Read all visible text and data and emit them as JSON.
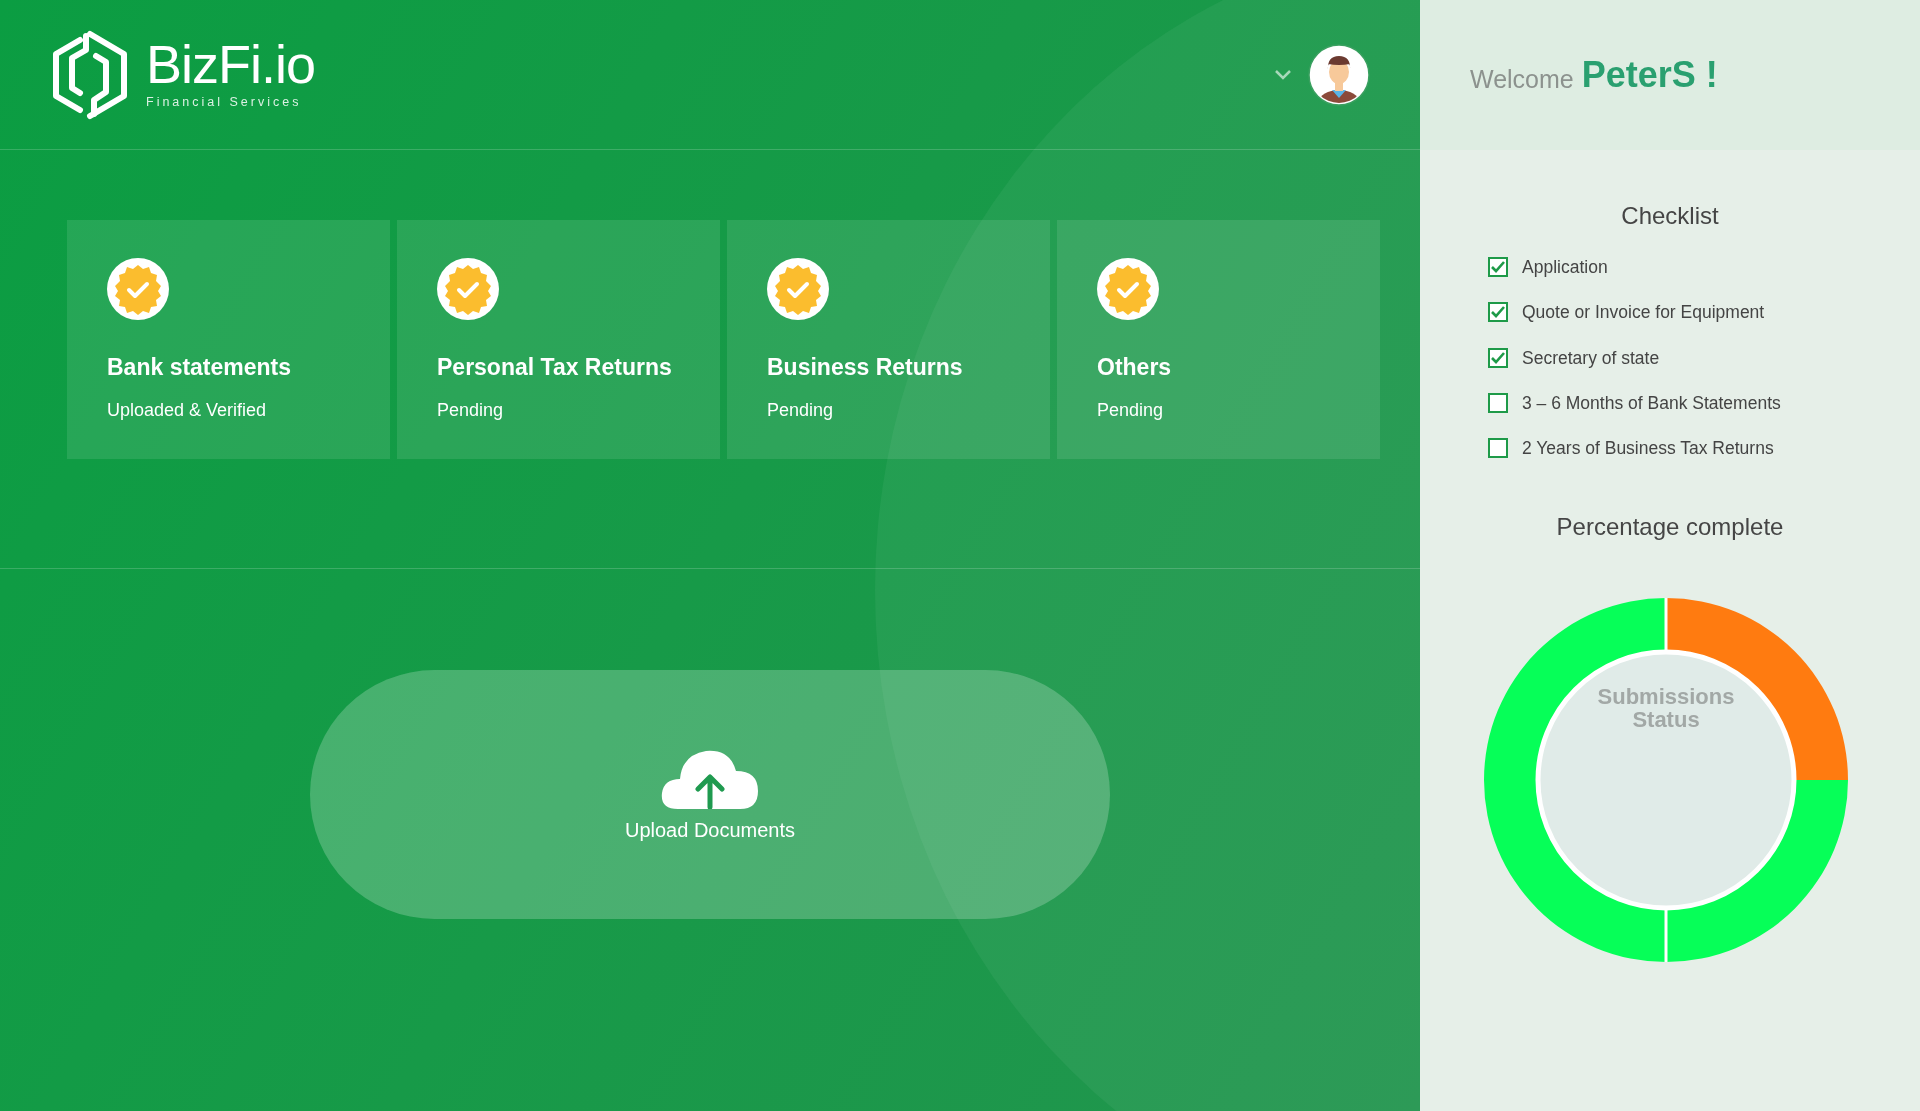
{
  "header": {
    "logo": {
      "name": "BizFi.io",
      "tagline": "Financial Services"
    }
  },
  "documents": [
    {
      "title": "Bank statements",
      "status": "Uploaded & Verified"
    },
    {
      "title": "Personal Tax Returns",
      "status": "Pending"
    },
    {
      "title": "Business Returns",
      "status": "Pending"
    },
    {
      "title": "Others",
      "status": "Pending"
    }
  ],
  "upload": {
    "label": "Upload Documents"
  },
  "sidebar": {
    "welcome": "Welcome",
    "user": "PeterS !",
    "checklist": {
      "title": "Checklist",
      "items": [
        {
          "label": "Application",
          "checked": true
        },
        {
          "label": "Quote or Invoice for Equipment",
          "checked": true
        },
        {
          "label": "Secretary of state",
          "checked": true
        },
        {
          "label": "3 – 6 Months of Bank Statements",
          "checked": false
        },
        {
          "label": "2 Years of Business Tax Returns",
          "checked": false
        }
      ]
    },
    "progress": {
      "title": "Percentage complete",
      "center_label": "Submissions Status"
    }
  }
}
